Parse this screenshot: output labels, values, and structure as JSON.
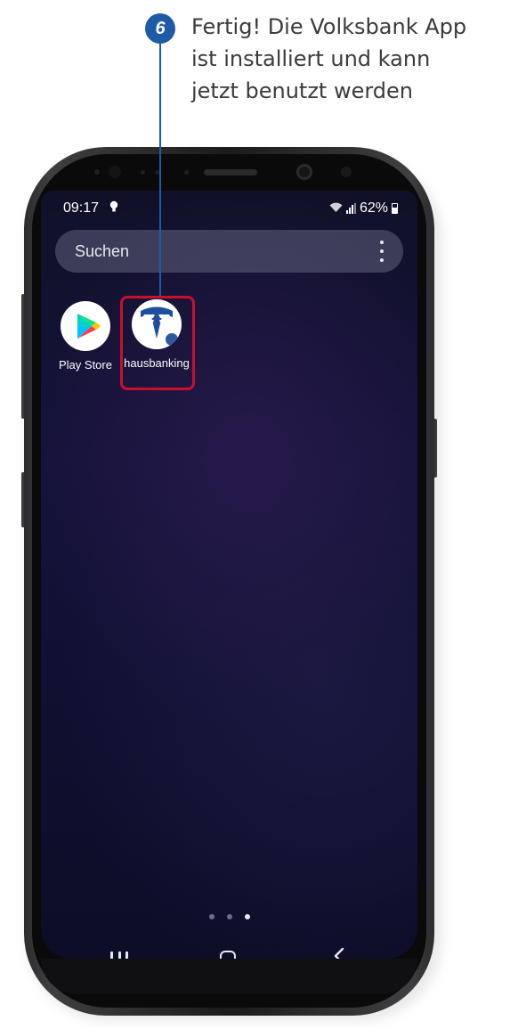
{
  "annotation": {
    "step_number": "6",
    "lines": [
      "Fertig! Die Volksbank App",
      "ist installiert und kann",
      "jetzt benutzt werden"
    ],
    "accent_color": "#1f5aa6",
    "highlight_color": "#c8102e"
  },
  "status_bar": {
    "time": "09:17",
    "notification_icon": "lightbulb-icon",
    "battery_percent": "62%",
    "battery_level": 0.62
  },
  "search": {
    "label": "Suchen",
    "menu_icon": "more-vertical-icon"
  },
  "apps": [
    {
      "label": "Play Store",
      "icon": "play-store-icon"
    },
    {
      "label": "hausbanking",
      "icon": "volksbank-icon"
    }
  ],
  "page_indicator": {
    "count": 3,
    "active_index": 2
  },
  "navigation": {
    "recent_icon": "recent-apps-icon",
    "home_icon": "home-icon",
    "back_icon": "back-icon"
  }
}
